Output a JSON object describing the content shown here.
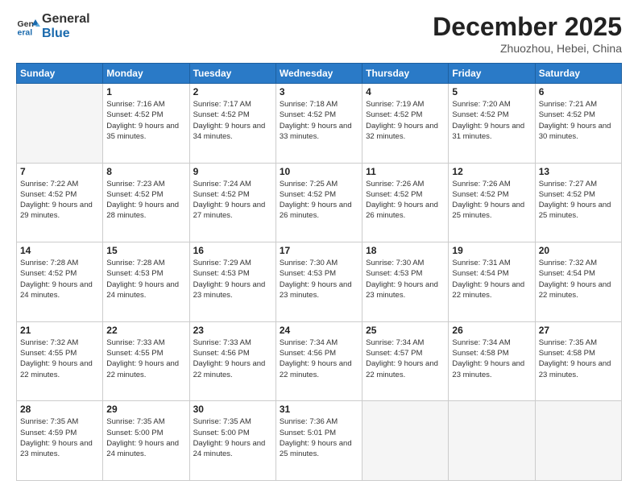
{
  "header": {
    "logo_line1": "General",
    "logo_line2": "Blue",
    "month": "December 2025",
    "location": "Zhuozhou, Hebei, China"
  },
  "days_of_week": [
    "Sunday",
    "Monday",
    "Tuesday",
    "Wednesday",
    "Thursday",
    "Friday",
    "Saturday"
  ],
  "weeks": [
    [
      {
        "day": "",
        "sunrise": "",
        "sunset": "",
        "daylight": ""
      },
      {
        "day": "1",
        "sunrise": "7:16 AM",
        "sunset": "4:52 PM",
        "daylight": "9 hours and 35 minutes."
      },
      {
        "day": "2",
        "sunrise": "7:17 AM",
        "sunset": "4:52 PM",
        "daylight": "9 hours and 34 minutes."
      },
      {
        "day": "3",
        "sunrise": "7:18 AM",
        "sunset": "4:52 PM",
        "daylight": "9 hours and 33 minutes."
      },
      {
        "day": "4",
        "sunrise": "7:19 AM",
        "sunset": "4:52 PM",
        "daylight": "9 hours and 32 minutes."
      },
      {
        "day": "5",
        "sunrise": "7:20 AM",
        "sunset": "4:52 PM",
        "daylight": "9 hours and 31 minutes."
      },
      {
        "day": "6",
        "sunrise": "7:21 AM",
        "sunset": "4:52 PM",
        "daylight": "9 hours and 30 minutes."
      }
    ],
    [
      {
        "day": "7",
        "sunrise": "7:22 AM",
        "sunset": "4:52 PM",
        "daylight": "9 hours and 29 minutes."
      },
      {
        "day": "8",
        "sunrise": "7:23 AM",
        "sunset": "4:52 PM",
        "daylight": "9 hours and 28 minutes."
      },
      {
        "day": "9",
        "sunrise": "7:24 AM",
        "sunset": "4:52 PM",
        "daylight": "9 hours and 27 minutes."
      },
      {
        "day": "10",
        "sunrise": "7:25 AM",
        "sunset": "4:52 PM",
        "daylight": "9 hours and 26 minutes."
      },
      {
        "day": "11",
        "sunrise": "7:26 AM",
        "sunset": "4:52 PM",
        "daylight": "9 hours and 26 minutes."
      },
      {
        "day": "12",
        "sunrise": "7:26 AM",
        "sunset": "4:52 PM",
        "daylight": "9 hours and 25 minutes."
      },
      {
        "day": "13",
        "sunrise": "7:27 AM",
        "sunset": "4:52 PM",
        "daylight": "9 hours and 25 minutes."
      }
    ],
    [
      {
        "day": "14",
        "sunrise": "7:28 AM",
        "sunset": "4:52 PM",
        "daylight": "9 hours and 24 minutes."
      },
      {
        "day": "15",
        "sunrise": "7:28 AM",
        "sunset": "4:53 PM",
        "daylight": "9 hours and 24 minutes."
      },
      {
        "day": "16",
        "sunrise": "7:29 AM",
        "sunset": "4:53 PM",
        "daylight": "9 hours and 23 minutes."
      },
      {
        "day": "17",
        "sunrise": "7:30 AM",
        "sunset": "4:53 PM",
        "daylight": "9 hours and 23 minutes."
      },
      {
        "day": "18",
        "sunrise": "7:30 AM",
        "sunset": "4:53 PM",
        "daylight": "9 hours and 23 minutes."
      },
      {
        "day": "19",
        "sunrise": "7:31 AM",
        "sunset": "4:54 PM",
        "daylight": "9 hours and 22 minutes."
      },
      {
        "day": "20",
        "sunrise": "7:32 AM",
        "sunset": "4:54 PM",
        "daylight": "9 hours and 22 minutes."
      }
    ],
    [
      {
        "day": "21",
        "sunrise": "7:32 AM",
        "sunset": "4:55 PM",
        "daylight": "9 hours and 22 minutes."
      },
      {
        "day": "22",
        "sunrise": "7:33 AM",
        "sunset": "4:55 PM",
        "daylight": "9 hours and 22 minutes."
      },
      {
        "day": "23",
        "sunrise": "7:33 AM",
        "sunset": "4:56 PM",
        "daylight": "9 hours and 22 minutes."
      },
      {
        "day": "24",
        "sunrise": "7:34 AM",
        "sunset": "4:56 PM",
        "daylight": "9 hours and 22 minutes."
      },
      {
        "day": "25",
        "sunrise": "7:34 AM",
        "sunset": "4:57 PM",
        "daylight": "9 hours and 22 minutes."
      },
      {
        "day": "26",
        "sunrise": "7:34 AM",
        "sunset": "4:58 PM",
        "daylight": "9 hours and 23 minutes."
      },
      {
        "day": "27",
        "sunrise": "7:35 AM",
        "sunset": "4:58 PM",
        "daylight": "9 hours and 23 minutes."
      }
    ],
    [
      {
        "day": "28",
        "sunrise": "7:35 AM",
        "sunset": "4:59 PM",
        "daylight": "9 hours and 23 minutes."
      },
      {
        "day": "29",
        "sunrise": "7:35 AM",
        "sunset": "5:00 PM",
        "daylight": "9 hours and 24 minutes."
      },
      {
        "day": "30",
        "sunrise": "7:35 AM",
        "sunset": "5:00 PM",
        "daylight": "9 hours and 24 minutes."
      },
      {
        "day": "31",
        "sunrise": "7:36 AM",
        "sunset": "5:01 PM",
        "daylight": "9 hours and 25 minutes."
      },
      {
        "day": "",
        "sunrise": "",
        "sunset": "",
        "daylight": ""
      },
      {
        "day": "",
        "sunrise": "",
        "sunset": "",
        "daylight": ""
      },
      {
        "day": "",
        "sunrise": "",
        "sunset": "",
        "daylight": ""
      }
    ]
  ]
}
